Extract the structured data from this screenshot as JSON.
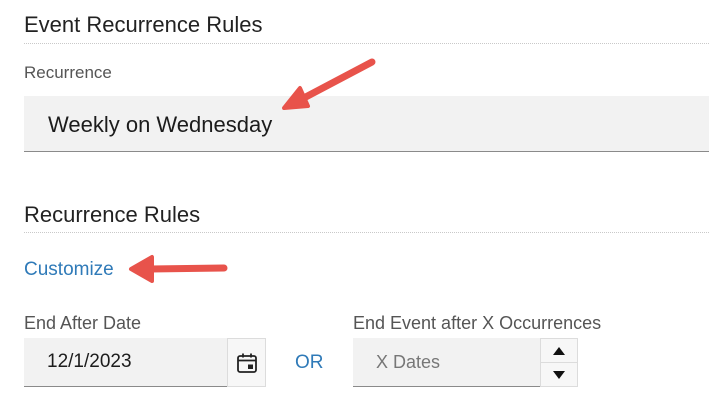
{
  "sections": {
    "event_rules_title": "Event Recurrence Rules",
    "recurrence_rules_title": "Recurrence Rules"
  },
  "recurrence": {
    "label": "Recurrence",
    "value": "Weekly on Wednesday"
  },
  "customize_link": "Customize",
  "end_after_date": {
    "label": "End After Date",
    "value": "12/1/2023"
  },
  "or_text": "OR",
  "end_after_occurrences": {
    "label": "End Event after X Occurrences",
    "placeholder": "X Dates"
  },
  "icons": {
    "calendar": "calendar-icon",
    "spin_up": "triangle-up-icon",
    "spin_down": "triangle-down-icon",
    "annotation_arrow": "red-arrow"
  },
  "colors": {
    "link": "#2f7ab8",
    "arrow": "#e8534b",
    "field_bg": "#f2f2f2"
  }
}
